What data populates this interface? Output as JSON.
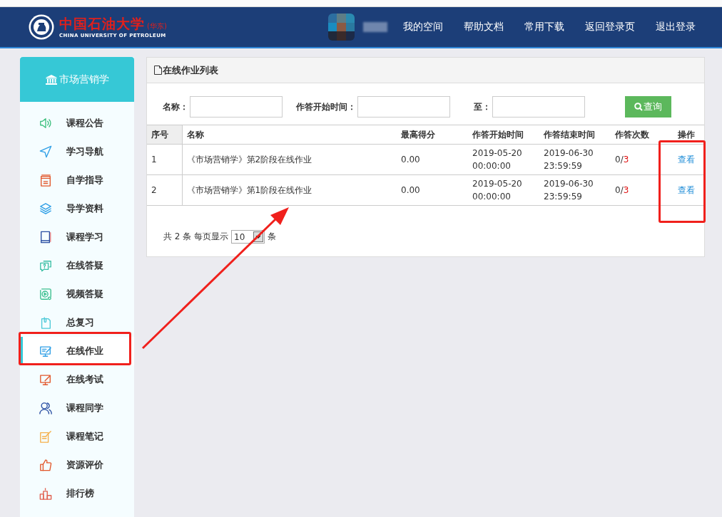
{
  "header": {
    "logo": {
      "name_cn": "中国石油大学",
      "campus": "(华东)",
      "name_en": "CHINA UNIVERSITY OF PETROLEUM"
    },
    "nav": [
      "我的空间",
      "帮助文档",
      "常用下载",
      "返回登录页",
      "退出登录"
    ]
  },
  "sidebar": {
    "course_title": "市场营销学",
    "items": [
      {
        "label": "课程公告",
        "selected": false
      },
      {
        "label": "学习导航",
        "selected": false
      },
      {
        "label": "自学指导",
        "selected": false
      },
      {
        "label": "导学资料",
        "selected": false
      },
      {
        "label": "课程学习",
        "selected": false
      },
      {
        "label": "在线答疑",
        "selected": false
      },
      {
        "label": "视频答疑",
        "selected": false
      },
      {
        "label": "总复习",
        "selected": false
      },
      {
        "label": "在线作业",
        "selected": true
      },
      {
        "label": "在线考试",
        "selected": false
      },
      {
        "label": "课程同学",
        "selected": false
      },
      {
        "label": "课程笔记",
        "selected": false
      },
      {
        "label": "资源评价",
        "selected": false
      },
      {
        "label": "排行榜",
        "selected": false
      }
    ]
  },
  "panel": {
    "title": "在线作业列表",
    "filters": [
      {
        "label": "名称："
      },
      {
        "label": "作答开始时间："
      },
      {
        "label": "至："
      }
    ],
    "search_button": "查询",
    "table": {
      "columns": [
        "序号",
        "名称",
        "最高得分",
        "作答开始时间",
        "作答结束时间",
        "作答次数",
        "操作"
      ],
      "rows": [
        {
          "index": "1",
          "name": "《市场营销学》第2阶段在线作业",
          "best_score": "0.00",
          "start_time": "2019-05-20 00:00:00",
          "end_time": "2019-06-30 23:59:59",
          "attempts_done": "0/",
          "attempts_limit": "3",
          "action": "查看"
        },
        {
          "index": "2",
          "name": "《市场营销学》第1阶段在线作业",
          "best_score": "0.00",
          "start_time": "2019-05-20 00:00:00",
          "end_time": "2019-06-30 23:59:59",
          "attempts_done": "0/",
          "attempts_limit": "3",
          "action": "查看"
        }
      ]
    },
    "pagination": {
      "summary": "共 2 条 每页显示",
      "page_size": "10",
      "suffix": "条"
    }
  },
  "annotations": [
    {
      "kind": "box"
    },
    {
      "kind": "box"
    },
    {
      "kind": "arrow"
    }
  ]
}
